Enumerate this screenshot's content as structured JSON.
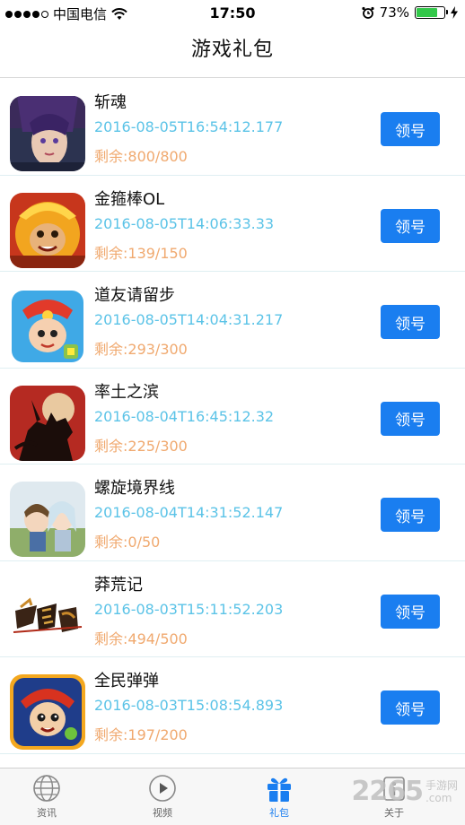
{
  "status_bar": {
    "carrier": "中国电信",
    "time": "17:50",
    "battery_percent": "73%",
    "battery_level": 0.73
  },
  "nav": {
    "title": "游戏礼包"
  },
  "claim_label": "领号",
  "games": [
    {
      "name": "斩魂",
      "time": "2016-08-05T16:54:12.177",
      "remain": "剩余:800/800",
      "icon": "zhanhun-game-icon"
    },
    {
      "name": "金箍棒OL",
      "time": "2016-08-05T14:06:33.33",
      "remain": "剩余:139/150",
      "icon": "jingubang-game-icon"
    },
    {
      "name": "道友请留步",
      "time": "2016-08-05T14:04:31.217",
      "remain": "剩余:293/300",
      "icon": "daoyou-game-icon"
    },
    {
      "name": "率土之滨",
      "time": "2016-08-04T16:45:12.32",
      "remain": "剩余:225/300",
      "icon": "shuaitu-game-icon"
    },
    {
      "name": "螺旋境界线",
      "time": "2016-08-04T14:31:52.147",
      "remain": "剩余:0/50",
      "icon": "luoxuan-game-icon"
    },
    {
      "name": "莽荒记",
      "time": "2016-08-03T15:11:52.203",
      "remain": "剩余:494/500",
      "icon": "manghuang-game-icon"
    },
    {
      "name": "全民弹弹",
      "time": "2016-08-03T15:08:54.893",
      "remain": "剩余:197/200",
      "icon": "quanmin-game-icon"
    }
  ],
  "tabs": [
    {
      "label": "资讯",
      "icon": "globe-icon"
    },
    {
      "label": "视频",
      "icon": "play-icon"
    },
    {
      "label": "礼包",
      "icon": "gift-icon",
      "active": true
    },
    {
      "label": "关于",
      "icon": "info-icon"
    }
  ],
  "watermark": {
    "brand": "2265",
    "sub1": "手游网",
    "sub2": ".com"
  },
  "colors": {
    "accent": "#1a7ef0",
    "time_text": "#5bc3e7",
    "remain_text": "#f0a96f"
  }
}
